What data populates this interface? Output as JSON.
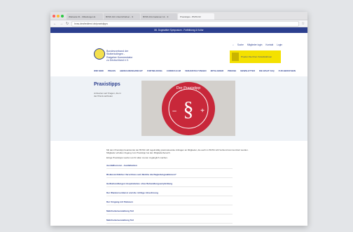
{
  "browser": {
    "tabs": [
      {
        "label": "Webseite 01 - Mitteilungen E"
      },
      {
        "label": "BVSS 101 Unterrichtsbuc... 9"
      },
      {
        "label": "BVSS Informationen 12... 9"
      },
      {
        "label": "Praxistipps - BVSS 93"
      }
    ],
    "url": "bvss.deafredirect.de/praxistipps"
  },
  "site": {
    "top_banner": "86. Dogmatiker Symposium - Fortbildung & Kultur",
    "logo_text": "Bundesverband der Stotterkollegen - Ratgeber Kommentator zu Deutschland e.V.",
    "search_links": [
      "Suche",
      "Mitglieder login",
      "Kontakt",
      "Login"
    ],
    "promo_text": "Pruefen Sie Ihren Vorteilsrahmen",
    "nav": [
      "WIR SIND",
      "PRAXIS",
      "ABRECHNUNG/RECHT",
      "FORTBILDUNG",
      "CURRICULUM",
      "VERANSTALTUNGEN",
      "MITGLIEDER",
      "PRESSE",
      "NEWSLETTER",
      "DIE WAHT FAQ",
      "FUR BERUFSEIN"
    ],
    "page_title": "Praxistipps",
    "hero_desc": "Antworten auf Fragen, die in der Praxis auftreten",
    "stamp_text": "Der Praxistipp",
    "intro": "Mit dem Praxistipp beantwortet der BVSS 120 regelmäßig praxisrelevante Anfragen an Mitglieder, die auch im BVSS 120 Verbund kommuniziert werden. Mitglieder erhalten Zugang zum Praxistipp bei den Mitgliederbereich.",
    "intro2": "Einige Praxistipps werden an für allen zeuren zugänglich machen.",
    "links": [
      "Ausfallhonorar - Ausfallzeiten",
      "Risikoreichtlicher Verschluss auf, Welche die Begleitungsaktionen?",
      "Heilbehandlungen Hospitalantes ohne Behandlungsempfehlung",
      "Der Wanderverdienst und die richtige Abrechnung",
      "Der Umgang mit Statusen",
      "Mehrheitenverwaltung Teil",
      "Mehrheitenverwaltung Teil"
    ]
  }
}
